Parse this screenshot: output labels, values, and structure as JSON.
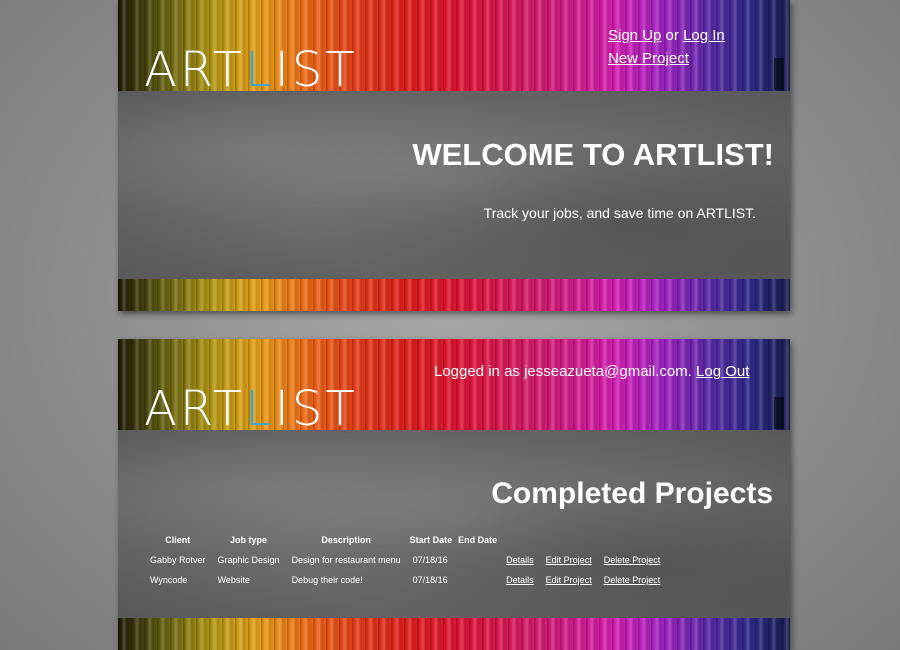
{
  "logo": {
    "text_before": "ART",
    "accent": "L",
    "text_after": "IST"
  },
  "colors": {
    "accent": "#38a7d6",
    "text": "#ffffff"
  },
  "screen1": {
    "nav": {
      "signup": "Sign Up",
      "or": "or",
      "login": "Log In",
      "new_project": "New Project"
    },
    "title": "WELCOME TO ARTLIST!",
    "subtitle": "Track your jobs, and save time on ARTLIST."
  },
  "screen2": {
    "nav": {
      "logged_in_text": "Logged in as jesseazueta@gmail.com.",
      "logout": "Log Out"
    },
    "title": "Completed Projects",
    "table": {
      "headers": [
        "Client",
        "Job type",
        "Description",
        "Start Date",
        "End Date"
      ],
      "rows": [
        {
          "client": "Gabby Rotver",
          "job_type": "Graphic Design",
          "description": "Design for restaurant menu",
          "start_date": "07/18/16",
          "end_date": "",
          "details": "Details",
          "edit": "Edit Project",
          "delete": "Delete Project"
        },
        {
          "client": "Wyncode",
          "job_type": "Website",
          "description": "Debug their code!",
          "start_date": "07/18/16",
          "end_date": "",
          "details": "Details",
          "edit": "Edit Project",
          "delete": "Delete Project"
        }
      ]
    }
  }
}
